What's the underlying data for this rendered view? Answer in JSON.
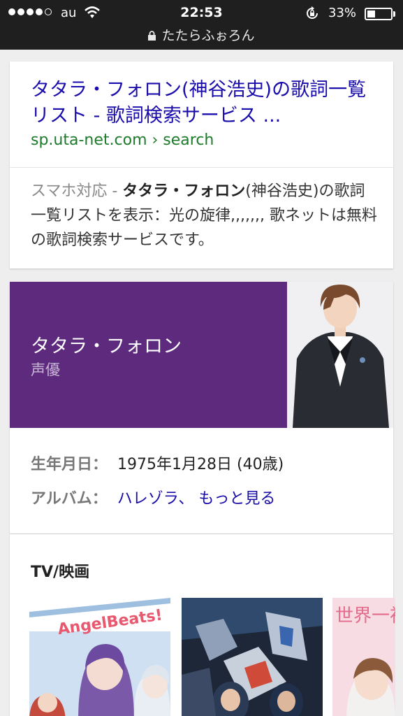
{
  "status_bar": {
    "carrier": "au",
    "time": "22:53",
    "battery_percent": "33%",
    "battery_level": 0.33,
    "signal_bars": 4,
    "url": "たたらふぉろん"
  },
  "result": {
    "title": "タタラ・フォロン(神谷浩史)の歌詞一覧リスト - 歌詞検索サービス ...",
    "url": "sp.uta-net.com › search",
    "snippet_prefix": "スマホ対応 - ",
    "snippet_bold": "タタラ・フォロン",
    "snippet_rest": "(神谷浩史)の歌詞一覧リストを表示：光の旋律,,,,,,, 歌ネットは無料の歌詞検索サービスです。"
  },
  "knowledge_panel": {
    "name": "タタラ・フォロン",
    "role": "声優",
    "accent_color": "#5e2a7e",
    "facts": {
      "birth_label": "生年月日：",
      "birth_value": "1975年1月28日 (40歳)",
      "album_label": "アルバム：",
      "album_value": "ハレゾラ、",
      "more_link": "もっと見る"
    }
  },
  "tv_section": {
    "title": "TV/映画",
    "thumb1_logo": "AngelBeats!",
    "thumb3_logo": "世界一初"
  }
}
